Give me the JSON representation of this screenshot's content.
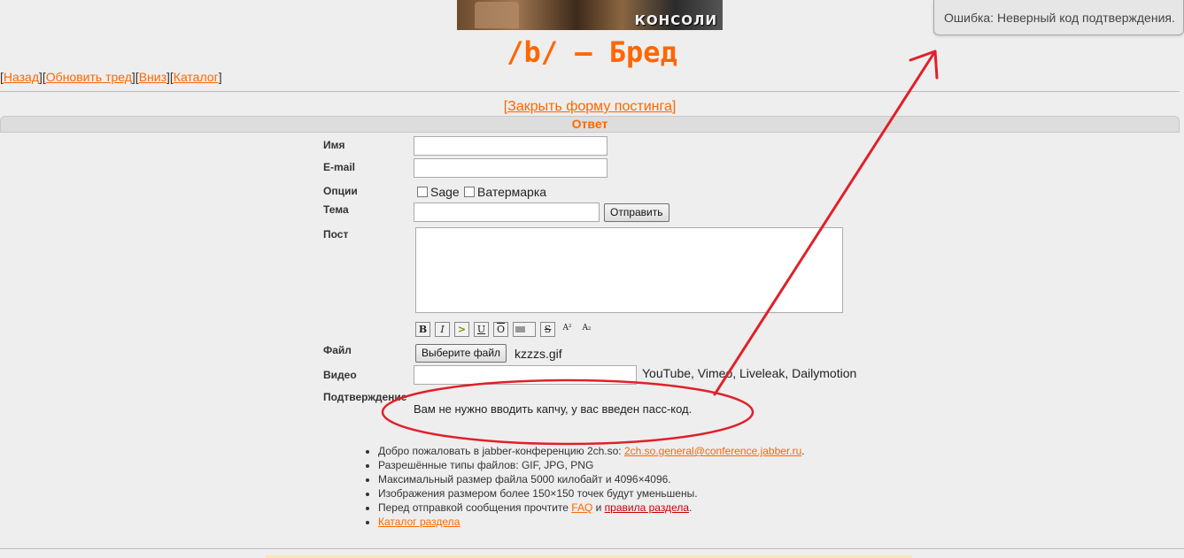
{
  "banner": {
    "text": "КОНСОЛИ"
  },
  "board": {
    "title": "/b/ – Бред"
  },
  "nav": {
    "items": [
      {
        "label": "Назад"
      },
      {
        "label": "Обновить тред"
      },
      {
        "label": "Вниз"
      },
      {
        "label": "Каталог"
      }
    ]
  },
  "form": {
    "toggle_label": "[Закрыть форму постинга]",
    "section_title": "Ответ",
    "name_label": "Имя",
    "name_value": "",
    "email_label": "E-mail",
    "email_value": "",
    "options_label": "Опции",
    "sage_label": "Sage",
    "watermark_label": "Ватермарка",
    "subject_label": "Тема",
    "subject_value": "",
    "submit_label": "Отправить",
    "post_label": "Пост",
    "post_value": "",
    "format_buttons": [
      {
        "label": "B"
      },
      {
        "label": "I"
      },
      {
        "label": ">"
      },
      {
        "label": "U"
      },
      {
        "label": "O"
      },
      {
        "label": ""
      },
      {
        "label": "S"
      },
      {
        "label": "A²"
      },
      {
        "label": "A₂"
      }
    ],
    "file_label": "Файл",
    "file_button_label": "Выберите файл",
    "file_name": "kzzzs.gif",
    "video_label": "Видео",
    "video_value": "",
    "video_hint": "YouTube, Vimeo, Liveleak, Dailymotion",
    "confirm_label": "Подтверждение",
    "pass_note": "Вам не нужно вводить капчу, у вас введен пасс-код."
  },
  "rules": {
    "jabber_prefix": "Добро пожаловать в jabber-конференцию 2ch.so: ",
    "jabber_link": "2ch.so.general@conference.jabber.ru",
    "jabber_suffix": ".",
    "file_types": "Разрешённые типы файлов: GIF, JPG, PNG",
    "max_size": "Максимальный размер файла 5000 килобайт и 4096×4096.",
    "resize": "Изображения размером более 150×150 точек будут уменьшены.",
    "read_prefix": "Перед отправкой сообщения прочтите ",
    "faq_link": "FAQ",
    "and": " и ",
    "rules_link": "правила раздела",
    "read_suffix": ".",
    "catalog_link": "Каталог раздела"
  },
  "error": {
    "message": "Ошибка: Неверный код подтверждения."
  },
  "colors": {
    "accent": "#ff6600",
    "annotation": "#e0202a",
    "background": "#eeeeee"
  }
}
